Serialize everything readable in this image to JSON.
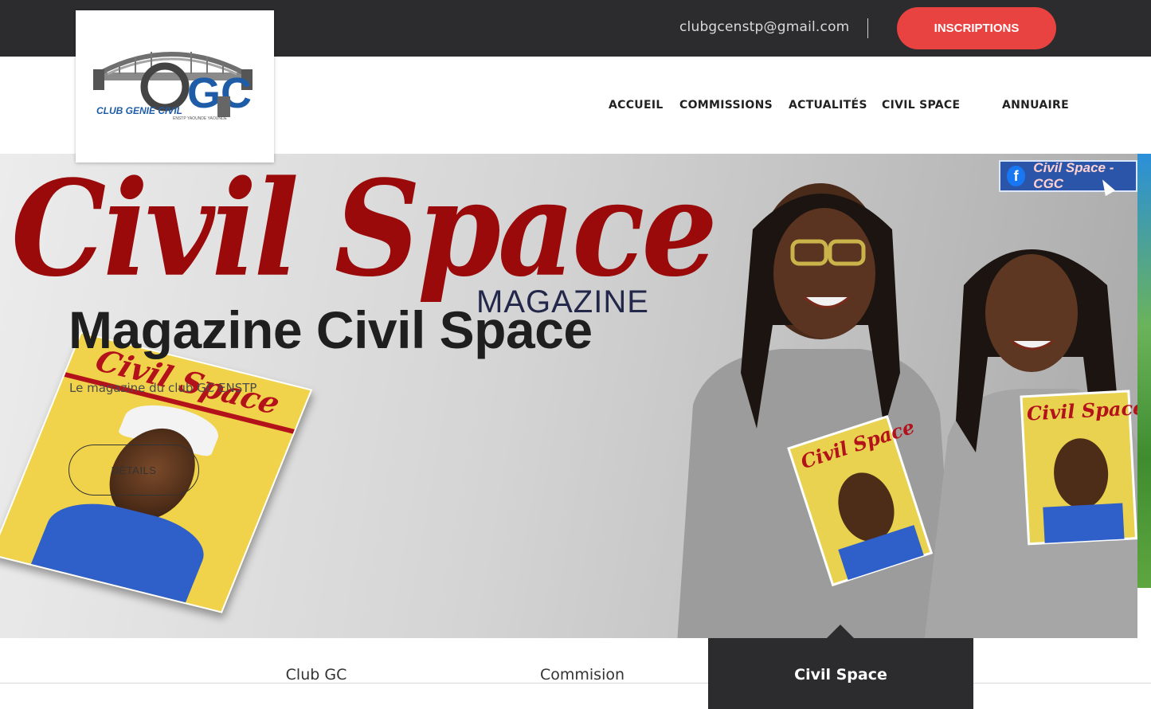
{
  "topbar": {
    "email": "clubgcenstp@gmail.com",
    "inscriptions_label": "INSCRIPTIONS"
  },
  "logo": {
    "text": "CLUB GENIE CIVIL",
    "mark": "GC",
    "tagline": "ENSTP YAOUNDE YAOUNDE"
  },
  "nav": {
    "items": [
      "ACCUEIL",
      "COMMISSIONS",
      "ACTUALITÉS",
      "CIVIL SPACE",
      "ANNUAIRE"
    ]
  },
  "hero": {
    "magazine_logo": "Civil Space",
    "magazine_logo_sub": "MAGAZINE",
    "title": "Magazine Civil Space",
    "subtitle": "Le magazine du club GC ENSTP",
    "details_label": "DÉTAILS",
    "cover_title": "Civil Space",
    "facebook_badge": "Civil Space - CGC"
  },
  "tabs": {
    "items": [
      "Club GC",
      "Commision",
      "Civil Space"
    ],
    "active": "Civil Space"
  },
  "colors": {
    "topbar": "#2c2c2e",
    "accent": "#e84340",
    "magazine_red": "#9a0a0a"
  }
}
